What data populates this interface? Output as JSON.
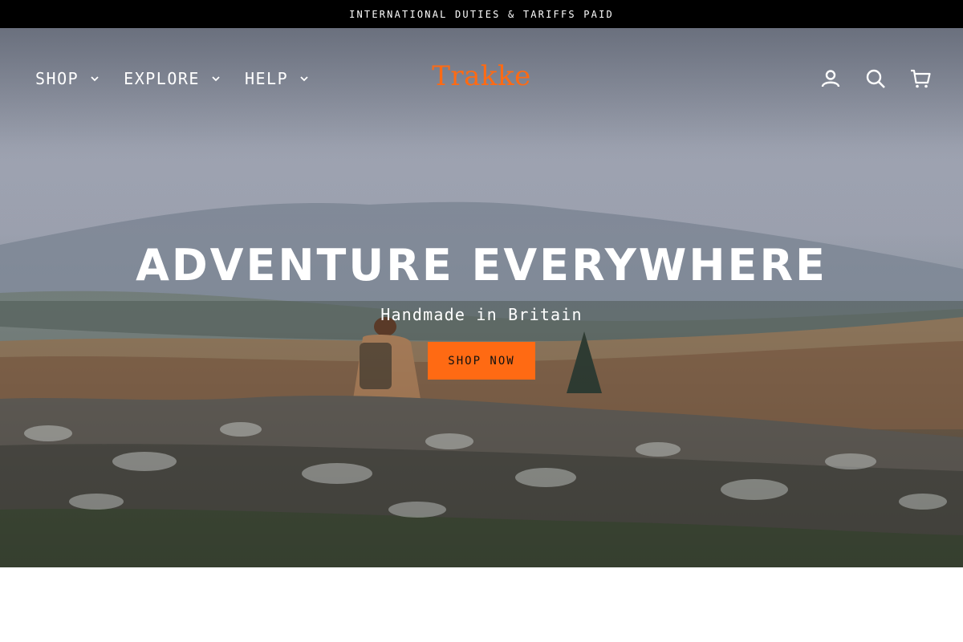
{
  "announcement": {
    "text": "INTERNATIONAL DUTIES & TARIFFS PAID"
  },
  "header": {
    "logo": "Trakke",
    "nav_left": [
      {
        "label": "SHOP",
        "icon": "chevron-down-icon"
      },
      {
        "label": "EXPLORE",
        "icon": "chevron-down-icon"
      },
      {
        "label": "HELP",
        "icon": "chevron-down-icon"
      }
    ],
    "nav_right_icons": [
      "account-icon",
      "search-icon",
      "cart-icon"
    ]
  },
  "hero": {
    "headline": "ADVENTURE EVERYWHERE",
    "subheadline": "Handmade in Britain",
    "cta_label": "SHOP NOW"
  },
  "colors": {
    "accent": "#ff6a13",
    "announcement_bg": "#000000",
    "text_on_hero": "#ffffff"
  }
}
